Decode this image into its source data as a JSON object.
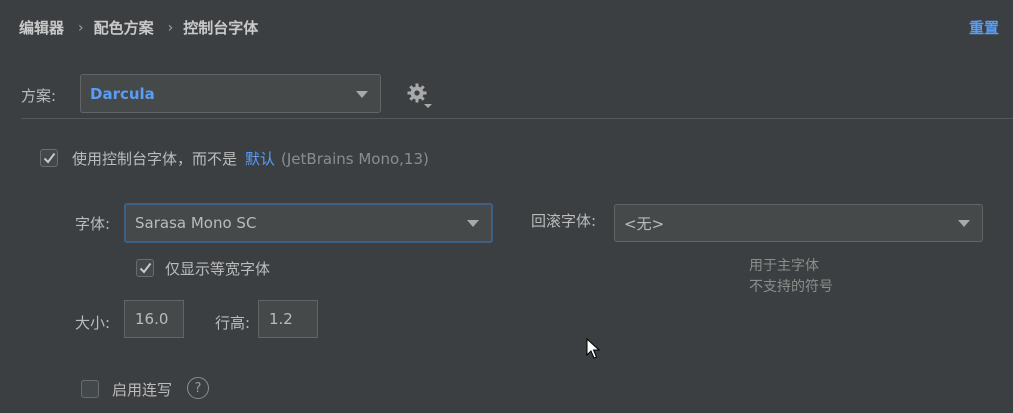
{
  "breadcrumb": {
    "items": [
      "编辑器",
      "配色方案",
      "控制台字体"
    ],
    "separator": "›"
  },
  "reset_label": "重置",
  "scheme": {
    "label": "方案:",
    "value": "Darcula"
  },
  "use_console_font": {
    "checked": true,
    "label": "使用控制台字体，而不是",
    "default_link": "默认",
    "default_detail": "(JetBrains Mono,13)"
  },
  "font": {
    "label": "字体:",
    "value": "Sarasa Mono SC"
  },
  "fallback_font": {
    "label": "回滚字体:",
    "value": "<无>",
    "hint_line1": "用于主字体",
    "hint_line2": "不支持的符号"
  },
  "monospaced_only": {
    "checked": true,
    "label": "仅显示等宽字体"
  },
  "size": {
    "label": "大小:",
    "value": "16.0"
  },
  "line_height": {
    "label": "行高:",
    "value": "1.2"
  },
  "ligatures": {
    "checked": false,
    "label": "启用连写"
  },
  "icons": {
    "gear": "gear-icon",
    "help": "help-icon",
    "dropdown": "chevron-down-icon"
  },
  "colors": {
    "background": "#3c3f41",
    "accent": "#589df6",
    "focus_border": "#3d6185"
  }
}
